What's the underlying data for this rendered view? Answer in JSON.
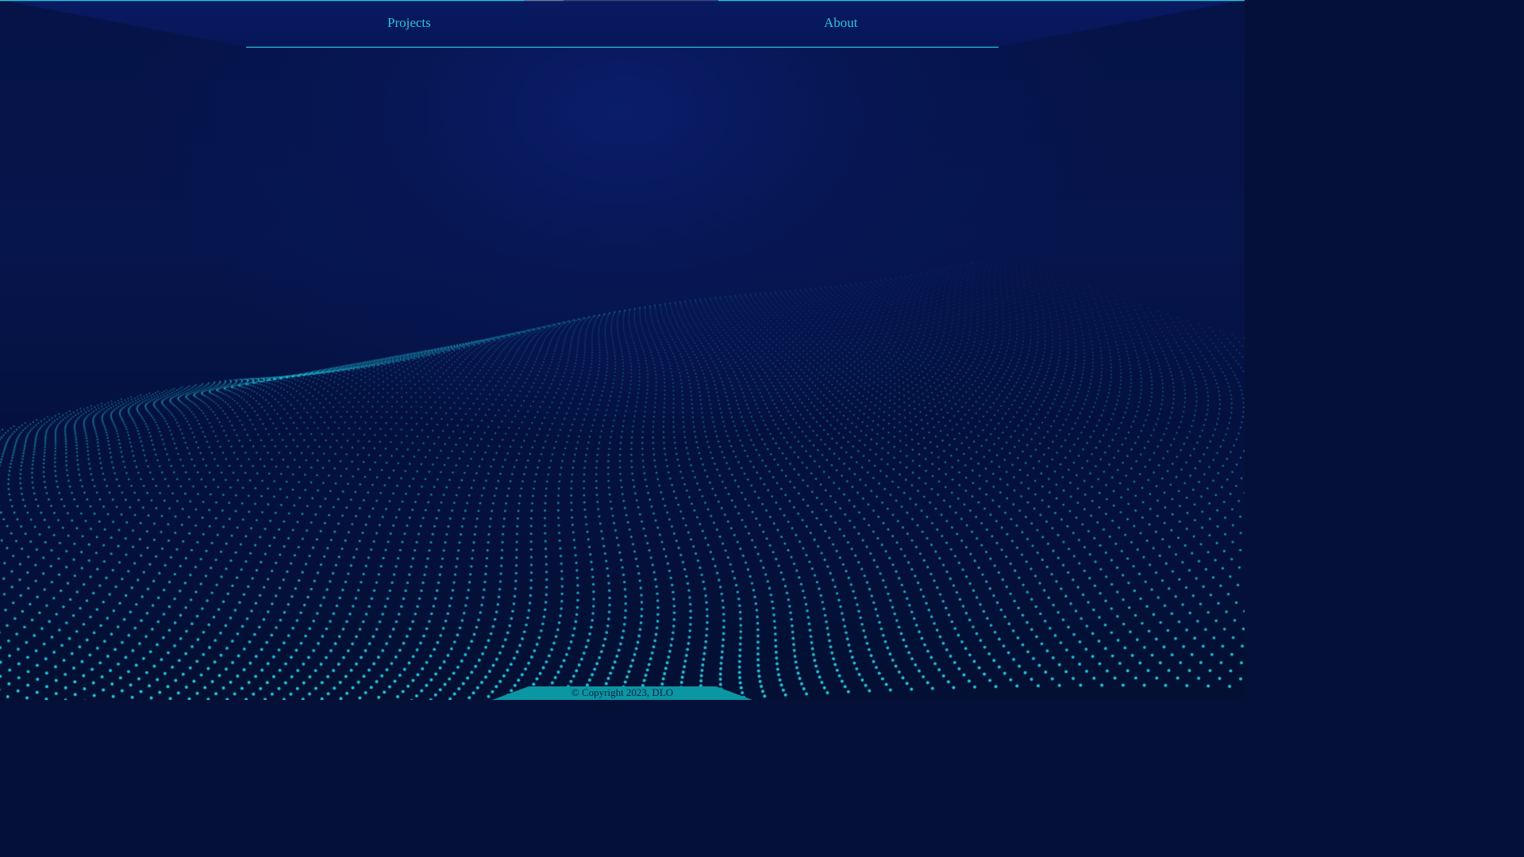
{
  "nav": {
    "links": [
      {
        "label": "Projects"
      },
      {
        "label": "About"
      }
    ]
  },
  "footer": {
    "copyright": "© Copyright 2023, DLO"
  },
  "colors": {
    "background": "#051347",
    "accent": "#2cc4d8",
    "nav_background": "#061658",
    "footer_background": "#0a97a3",
    "dots": "#25c8dc"
  },
  "background": {
    "description_icon": "particle-wave-background"
  }
}
